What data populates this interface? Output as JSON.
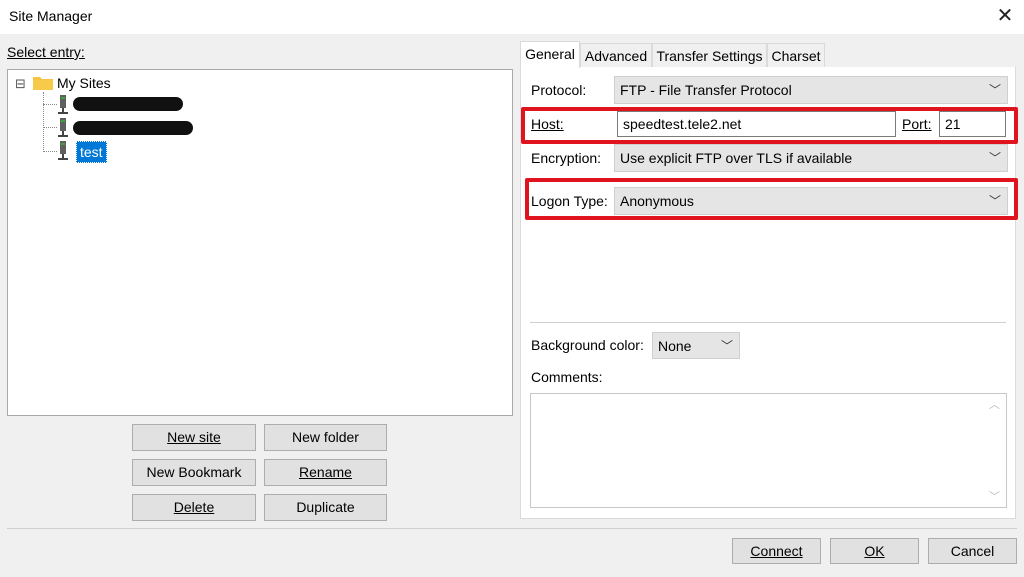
{
  "window": {
    "title": "Site Manager",
    "close_glyph": "✕"
  },
  "left": {
    "select_entry_label": "Select entry:",
    "tree": {
      "expander_glyph": "⊟",
      "root_label": "My Sites",
      "items": [
        {
          "label": "",
          "redacted": true
        },
        {
          "label": "",
          "redacted": true
        },
        {
          "label": "test",
          "selected": true
        }
      ]
    },
    "buttons": {
      "new_site": "New site",
      "new_folder": "New folder",
      "new_bookmark": "New Bookmark",
      "rename": "Rename",
      "delete": "Delete",
      "duplicate": "Duplicate"
    }
  },
  "tabs": [
    "General",
    "Advanced",
    "Transfer Settings",
    "Charset"
  ],
  "active_tab": "General",
  "general": {
    "protocol_label": "Protocol:",
    "protocol_value": "FTP - File Transfer Protocol",
    "host_label": "Host:",
    "host_value": "speedtest.tele2.net",
    "port_label": "Port:",
    "port_value": "21",
    "encryption_label": "Encryption:",
    "encryption_value": "Use explicit FTP over TLS if available",
    "logon_type_label": "Logon Type:",
    "logon_type_value": "Anonymous",
    "background_color_label": "Background color:",
    "background_color_value": "None",
    "comments_label": "Comments:",
    "comments_value": ""
  },
  "footer": {
    "connect": "Connect",
    "ok": "OK",
    "cancel": "Cancel"
  },
  "icons": {
    "dropdown": "chevron-down-icon",
    "folder": "folder-icon",
    "server": "server-icon"
  },
  "colors": {
    "highlight_red": "#e0141e",
    "selection_blue": "#0078d7",
    "folder_yellow": "#f6c343"
  }
}
